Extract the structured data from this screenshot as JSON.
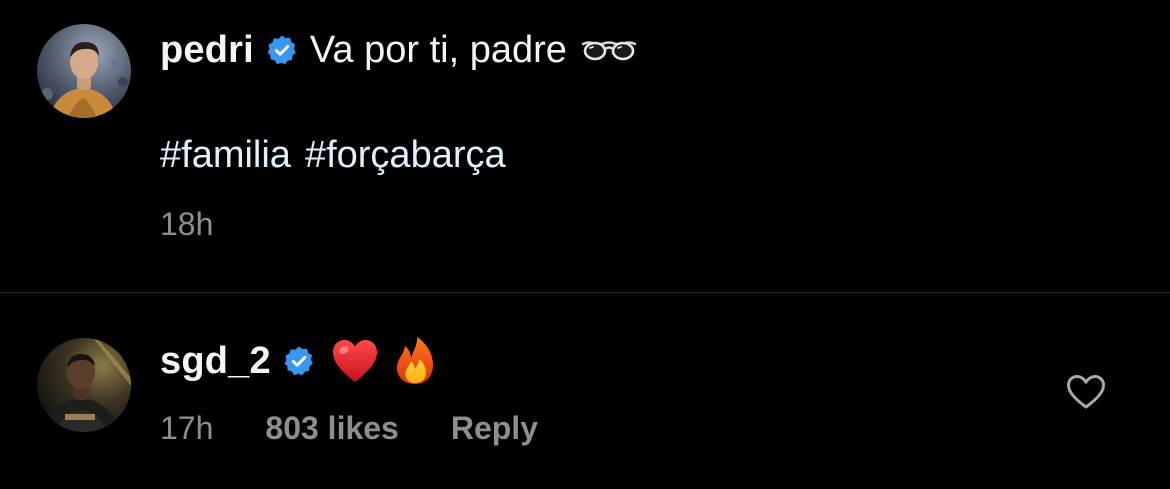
{
  "caption": {
    "username": "pedri",
    "verified": true,
    "text": "Va por ti, padre",
    "emoji": "glasses",
    "hashtags": [
      "#familia",
      "#forçabarça"
    ],
    "time": "18h"
  },
  "comment": {
    "username": "sgd_2",
    "verified": true,
    "emojis": [
      "red-heart",
      "fire"
    ],
    "time": "17h",
    "likes": "803 likes",
    "reply_label": "Reply"
  },
  "colors": {
    "background": "#000000",
    "text": "#f5f5f5",
    "hashtag": "#e0f1ff",
    "muted": "#8e8e8e",
    "verified_badge": "#3897f0",
    "divider": "#2a2a2a"
  },
  "icons": {
    "verified": "verified-badge-icon",
    "like": "heart-outline-icon"
  }
}
